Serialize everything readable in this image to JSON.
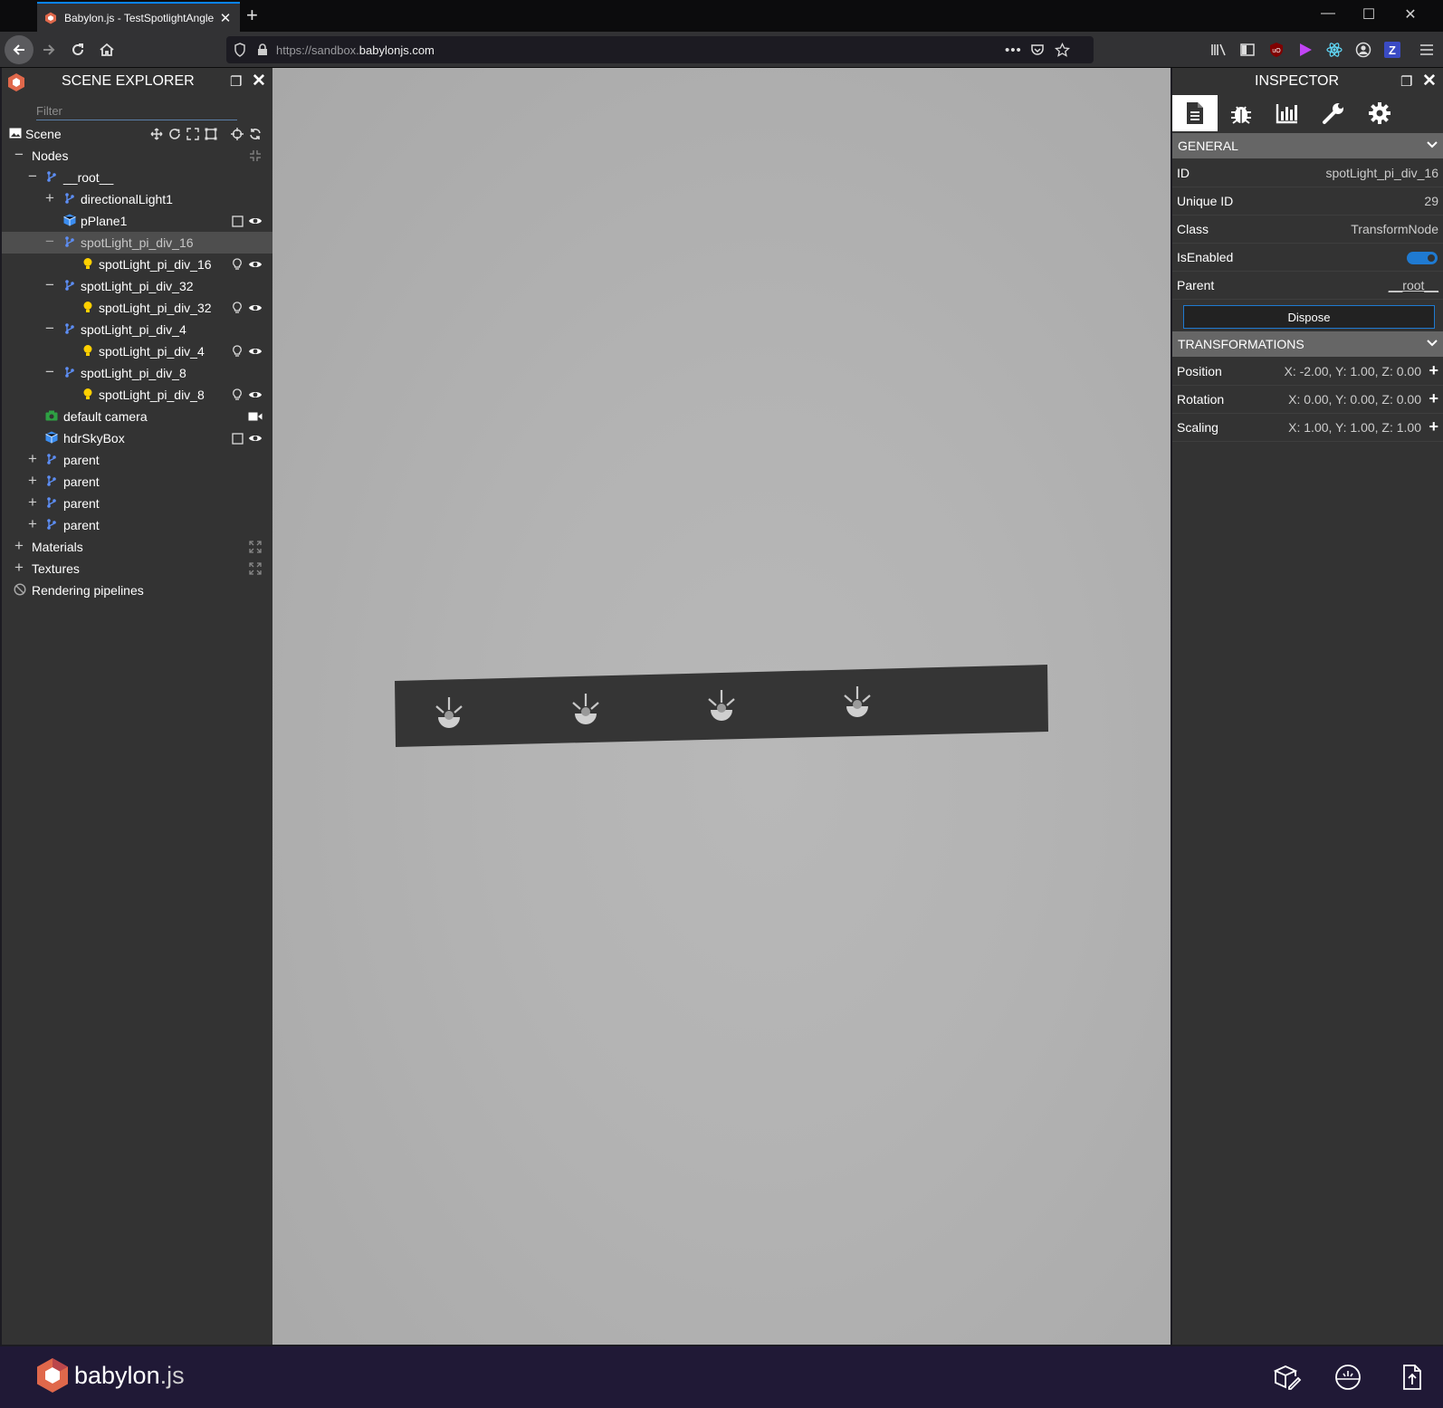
{
  "browser": {
    "tab_title": "Babylon.js - TestSpotlightAngle",
    "url_prefix": "https://sandbox.",
    "url_host": "babylonjs.com",
    "win_min": "—",
    "win_max": "☐",
    "win_close": "✕"
  },
  "explorer": {
    "title": "SCENE EXPLORER",
    "filter_placeholder": "Filter",
    "scene_label": "Scene",
    "nodes": [
      {
        "label": "Nodes",
        "toggle": "−"
      },
      {
        "label": "__root__",
        "toggle": "−"
      },
      {
        "label": "directionalLight1",
        "toggle": "+"
      },
      {
        "label": "pPlane1",
        "toggle": ""
      },
      {
        "label": "spotLight_pi_div_16",
        "toggle": "−"
      },
      {
        "label": "spotLight_pi_div_16",
        "toggle": ""
      },
      {
        "label": "spotLight_pi_div_32",
        "toggle": "−"
      },
      {
        "label": "spotLight_pi_div_32",
        "toggle": ""
      },
      {
        "label": "spotLight_pi_div_4",
        "toggle": "−"
      },
      {
        "label": "spotLight_pi_div_4",
        "toggle": ""
      },
      {
        "label": "spotLight_pi_div_8",
        "toggle": "−"
      },
      {
        "label": "spotLight_pi_div_8",
        "toggle": ""
      },
      {
        "label": "default camera",
        "toggle": ""
      },
      {
        "label": "hdrSkyBox",
        "toggle": ""
      },
      {
        "label": "parent",
        "toggle": "+"
      },
      {
        "label": "parent",
        "toggle": "+"
      },
      {
        "label": "parent",
        "toggle": "+"
      },
      {
        "label": "parent",
        "toggle": "+"
      },
      {
        "label": "Materials",
        "toggle": "+"
      },
      {
        "label": "Textures",
        "toggle": "+"
      },
      {
        "label": "Rendering pipelines",
        "toggle": ""
      }
    ]
  },
  "inspector": {
    "title": "INSPECTOR",
    "general": {
      "header": "GENERAL",
      "id_label": "ID",
      "id_value": "spotLight_pi_div_16",
      "uid_label": "Unique ID",
      "uid_value": "29",
      "class_label": "Class",
      "class_value": "TransformNode",
      "enabled_label": "IsEnabled",
      "enabled_value": true,
      "parent_label": "Parent",
      "parent_value": "__root__",
      "dispose_label": "Dispose"
    },
    "transforms": {
      "header": "TRANSFORMATIONS",
      "position_label": "Position",
      "position_value": "X: -2.00, Y: 1.00, Z: 0.00",
      "rotation_label": "Rotation",
      "rotation_value": "X: 0.00, Y: 0.00, Z: 0.00",
      "scaling_label": "Scaling",
      "scaling_value": "X: 1.00, Y: 1.00, Z: 1.00"
    }
  },
  "footer": {
    "brand_name": "babylon",
    "brand_suffix": ".js"
  },
  "colors": {
    "accent": "#1f7ad1",
    "node_blue": "#5d8ef5",
    "light_yellow": "#ffd000",
    "camera_green": "#2ea043",
    "footer_bg": "#201936"
  }
}
